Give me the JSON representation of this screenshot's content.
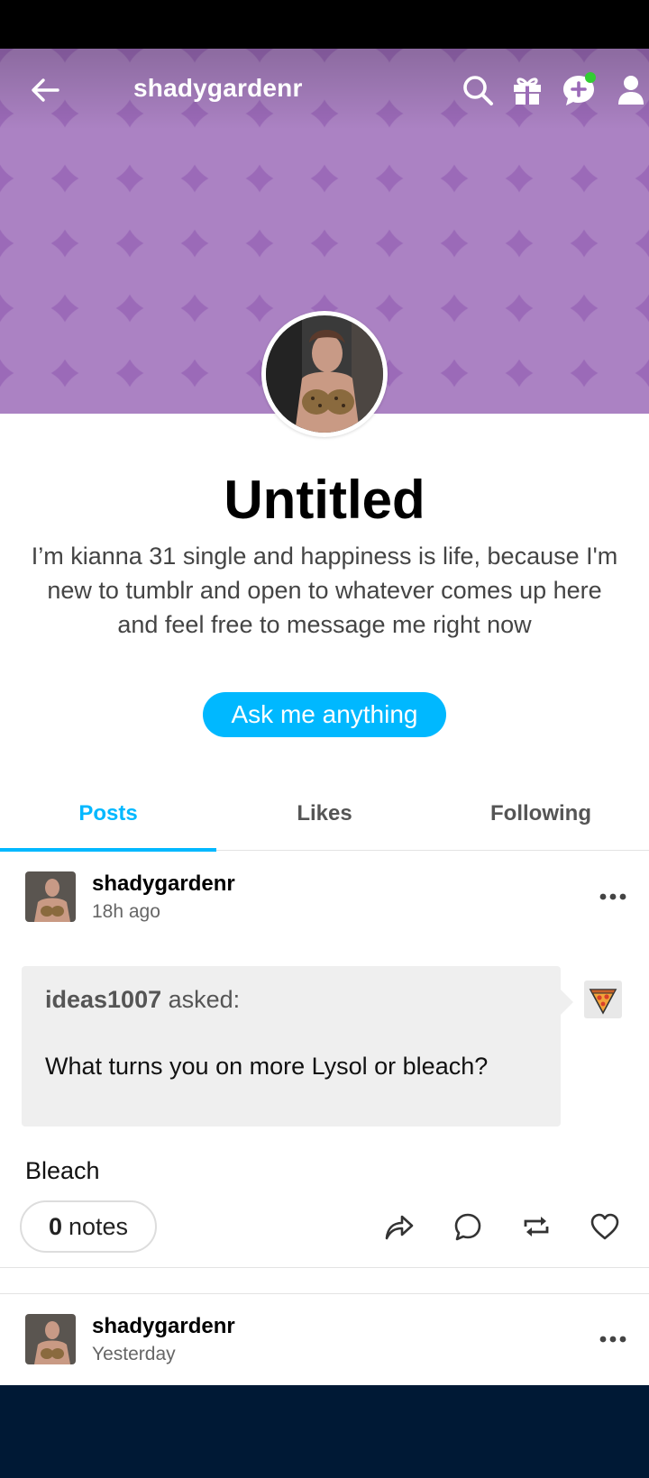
{
  "header": {
    "blog_name": "shadygardenr",
    "colors": {
      "background": "#9b6ab8",
      "accent": "#00b8ff",
      "notification": "#33cc33"
    },
    "icons": [
      "arrow-left-icon",
      "search-icon",
      "gift-icon",
      "new-message-icon",
      "account-icon"
    ]
  },
  "profile": {
    "title": "Untitled",
    "description": "I’m kianna 31 single and happiness is life, because I'm new to tumblr and open to whatever comes up here and feel free to message me right now",
    "ask_button": "Ask me anything"
  },
  "tabs": [
    {
      "label": "Posts",
      "active": true
    },
    {
      "label": "Likes",
      "active": false
    },
    {
      "label": "Following",
      "active": false
    }
  ],
  "posts": [
    {
      "username": "shadygardenr",
      "time": "18h ago",
      "asker": "ideas1007",
      "asked_label": "asked:",
      "question": "What turns you on more Lysol or bleach?",
      "answer": "Bleach",
      "notes_count": "0",
      "notes_label": "notes",
      "actions": [
        "share-icon",
        "reply-icon",
        "reblog-icon",
        "like-icon"
      ]
    },
    {
      "username": "shadygardenr",
      "time": "Yesterday"
    }
  ]
}
